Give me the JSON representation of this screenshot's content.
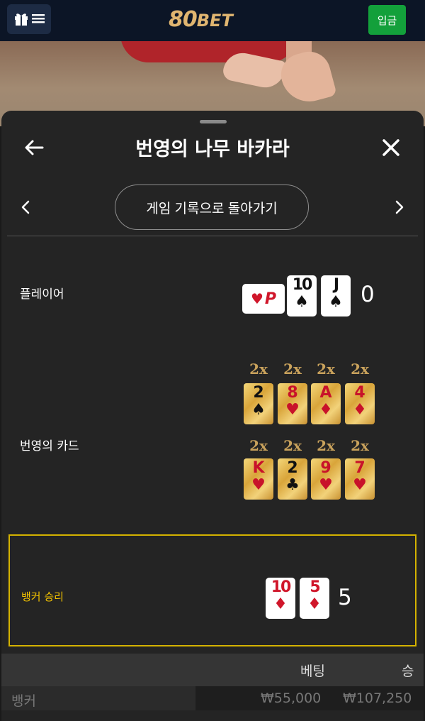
{
  "header": {
    "logo_big": "80",
    "logo_small": "BET",
    "deposit_label": "입금"
  },
  "modal": {
    "title": "번영의 나무 바카라",
    "back_to_history": "게임 기록으로 돌아가기"
  },
  "player": {
    "label": "플레이어",
    "score": "0",
    "special_card": {
      "suit": "♥",
      "symbol": "P"
    },
    "cards": [
      {
        "rank": "10",
        "suit": "♠",
        "color": "black"
      },
      {
        "rank": "J",
        "suit": "♠",
        "color": "black"
      }
    ]
  },
  "lucky_cards": {
    "label": "번영의 카드",
    "rows": [
      [
        {
          "mult": "2x",
          "rank": "2",
          "suit": "♠",
          "color": "black"
        },
        {
          "mult": "2x",
          "rank": "8",
          "suit": "♥",
          "color": "red"
        },
        {
          "mult": "2x",
          "rank": "A",
          "suit": "♦",
          "color": "red"
        },
        {
          "mult": "2x",
          "rank": "4",
          "suit": "♦",
          "color": "red"
        }
      ],
      [
        {
          "mult": "2x",
          "rank": "K",
          "suit": "♥",
          "color": "red"
        },
        {
          "mult": "2x",
          "rank": "2",
          "suit": "♣",
          "color": "black"
        },
        {
          "mult": "2x",
          "rank": "9",
          "suit": "♥",
          "color": "red"
        },
        {
          "mult": "2x",
          "rank": "7",
          "suit": "♥",
          "color": "red"
        }
      ]
    ]
  },
  "banker": {
    "label": "뱅커 승리",
    "score": "5",
    "cards": [
      {
        "rank": "10",
        "suit": "♦",
        "color": "red"
      },
      {
        "rank": "5",
        "suit": "♦",
        "color": "red"
      }
    ]
  },
  "table": {
    "headers": {
      "bet": "베팅",
      "win": "승"
    },
    "rows": [
      {
        "name": "뱅커",
        "bet": "₩55,000",
        "win": "₩107,250"
      }
    ]
  },
  "colors": {
    "accent_gold": "#e0b570",
    "deposit_green": "#13a03b",
    "win_border": "#d4b200"
  }
}
